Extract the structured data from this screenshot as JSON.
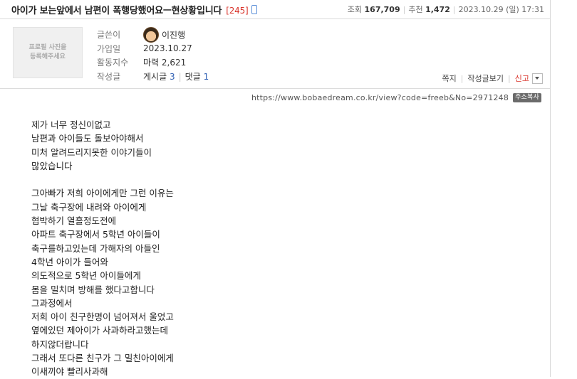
{
  "post": {
    "title": "아이가 보는앞에서 남편이 폭행당했어요ㅡ현상황입니다",
    "comment_count": "[245]",
    "views_label": "조회",
    "views": "167,709",
    "likes_label": "추천",
    "likes": "1,472",
    "date": "2023.10.29 (일) 17:31"
  },
  "writer": {
    "profile_placeholder_line1": "프로필 사진을",
    "profile_placeholder_line2": "등록해주세요",
    "author_label": "글쓴이",
    "author": "이진행",
    "joined_label": "가입일",
    "joined": "2023.10.27",
    "activity_label": "활동지수",
    "activity": "마력 2,621",
    "posts_label": "작성글",
    "posts_text": "게시글",
    "posts_count": "3",
    "comments_text": "댓글",
    "comments_count": "1"
  },
  "actions": {
    "note": "쪽지",
    "view_posts": "작성글보기",
    "report": "신고"
  },
  "url": {
    "address": "https://www.bobaedream.co.kr/view?code=freeb&No=2971248",
    "copy_label": "주소복사"
  },
  "content": {
    "lines": [
      "제가 너무 정신이없고",
      "남편과 아이들도 돌보아야해서",
      "미처 알려드리지못한 이야기들이",
      "많았습니다",
      "",
      "그아빠가 저희 아이에게만 그런 이유는",
      "그날 축구장에 내려와 아이에게",
      "협박하기 열흘정도전에",
      "아파트 축구장에서 5학년 아이들이",
      "축구를하고있는데 가해자의 아들인",
      "4학년 아이가 들어와",
      "의도적으로 5학년 아이들에게",
      "몸을 밀치며 방해를 했다고합니다",
      "그과정에서",
      "저희 아이 친구한명이 넘어져서 울었고",
      "옆에있던 제아이가 사과하라고했는데",
      "하지않더랍니다",
      "그래서 또다른 친구가 그 밀친아이에게",
      "이새끼야 빨리사과해"
    ]
  }
}
